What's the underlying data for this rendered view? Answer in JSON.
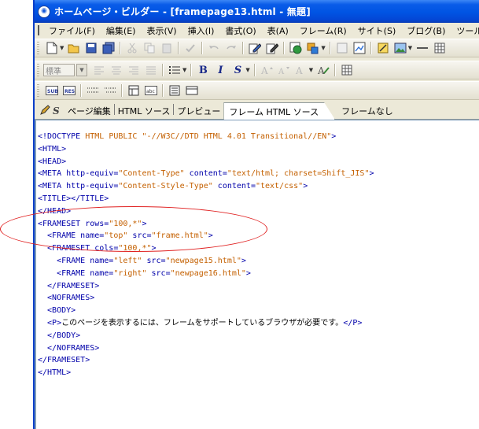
{
  "window": {
    "title": "ホームページ・ビルダー - [framepage13.html - 無題]"
  },
  "menu": [
    {
      "label": "ファイル(F)"
    },
    {
      "label": "編集(E)"
    },
    {
      "label": "表示(V)"
    },
    {
      "label": "挿入(I)"
    },
    {
      "label": "書式(O)"
    },
    {
      "label": "表(A)"
    },
    {
      "label": "フレーム(R)"
    },
    {
      "label": "サイト(S)"
    },
    {
      "label": "ブログ(B)"
    },
    {
      "label": "ツール(T)"
    }
  ],
  "toolbar2": {
    "style_select_value": "標準"
  },
  "tabs": [
    {
      "label": "ページ編集"
    },
    {
      "label": "HTML ソース"
    },
    {
      "label": "プレビュー"
    },
    {
      "label": "フレーム HTML ソース",
      "active": true
    },
    {
      "label": "フレームなし"
    }
  ],
  "code": [
    [
      {
        "t": "tag",
        "s": "<!DOCTYPE "
      },
      {
        "t": "val",
        "s": "HTML PUBLIC \"-//W3C//DTD HTML 4.01 Transitional//EN\""
      },
      {
        "t": "tag",
        "s": ">"
      }
    ],
    [
      {
        "t": "tag",
        "s": "<HTML>"
      }
    ],
    [
      {
        "t": "tag",
        "s": "<HEAD>"
      }
    ],
    [
      {
        "t": "tag",
        "s": "<META http-equiv="
      },
      {
        "t": "val",
        "s": "\"Content-Type\""
      },
      {
        "t": "tag",
        "s": " content="
      },
      {
        "t": "val",
        "s": "\"text/html; charset=Shift_JIS\""
      },
      {
        "t": "tag",
        "s": ">"
      }
    ],
    [
      {
        "t": "tag",
        "s": "<META http-equiv="
      },
      {
        "t": "val",
        "s": "\"Content-Style-Type\""
      },
      {
        "t": "tag",
        "s": " content="
      },
      {
        "t": "val",
        "s": "\"text/css\""
      },
      {
        "t": "tag",
        "s": ">"
      }
    ],
    [
      {
        "t": "tag",
        "s": "<TITLE></TITLE>"
      }
    ],
    [
      {
        "t": "tag",
        "s": "</HEAD>"
      }
    ],
    [
      {
        "t": "tag",
        "s": "<FRAMESET rows="
      },
      {
        "t": "val",
        "s": "\"100,*\""
      },
      {
        "t": "tag",
        "s": ">"
      }
    ],
    [
      {
        "t": "tag",
        "s": "  <FRAME name="
      },
      {
        "t": "val",
        "s": "\"top\""
      },
      {
        "t": "tag",
        "s": " src="
      },
      {
        "t": "val",
        "s": "\"frame.html\""
      },
      {
        "t": "tag",
        "s": ">"
      }
    ],
    [
      {
        "t": "tag",
        "s": "  <FRAMESET cols="
      },
      {
        "t": "val",
        "s": "\"100,*\""
      },
      {
        "t": "tag",
        "s": ">"
      }
    ],
    [
      {
        "t": "tag",
        "s": "    <FRAME name="
      },
      {
        "t": "val",
        "s": "\"left\""
      },
      {
        "t": "tag",
        "s": " src="
      },
      {
        "t": "val",
        "s": "\"newpage15.html\""
      },
      {
        "t": "tag",
        "s": ">"
      }
    ],
    [
      {
        "t": "tag",
        "s": "    <FRAME name="
      },
      {
        "t": "val",
        "s": "\"right\""
      },
      {
        "t": "tag",
        "s": " src="
      },
      {
        "t": "val",
        "s": "\"newpage16.html\""
      },
      {
        "t": "tag",
        "s": ">"
      }
    ],
    [
      {
        "t": "tag",
        "s": "  </FRAMESET>"
      }
    ],
    [
      {
        "t": "tag",
        "s": "  <NOFRAMES>"
      }
    ],
    [
      {
        "t": "tag",
        "s": "  <BODY>"
      }
    ],
    [
      {
        "t": "tag",
        "s": "  <P>"
      },
      {
        "t": "text",
        "s": "このページを表示するには、フレームをサポートしているブラウザが必要です。"
      },
      {
        "t": "tag",
        "s": "</P>"
      }
    ],
    [
      {
        "t": "tag",
        "s": "  </BODY>"
      }
    ],
    [
      {
        "t": "tag",
        "s": "  </NOFRAMES>"
      }
    ],
    [
      {
        "t": "tag",
        "s": "</FRAMESET>"
      }
    ],
    [
      {
        "t": "tag",
        "s": "</HTML>"
      }
    ]
  ],
  "annotation": {
    "color": "#e02020"
  },
  "colors": {
    "tag": "#0000aa",
    "attribute_value": "#c46000",
    "title_bar": "#0054e3"
  }
}
